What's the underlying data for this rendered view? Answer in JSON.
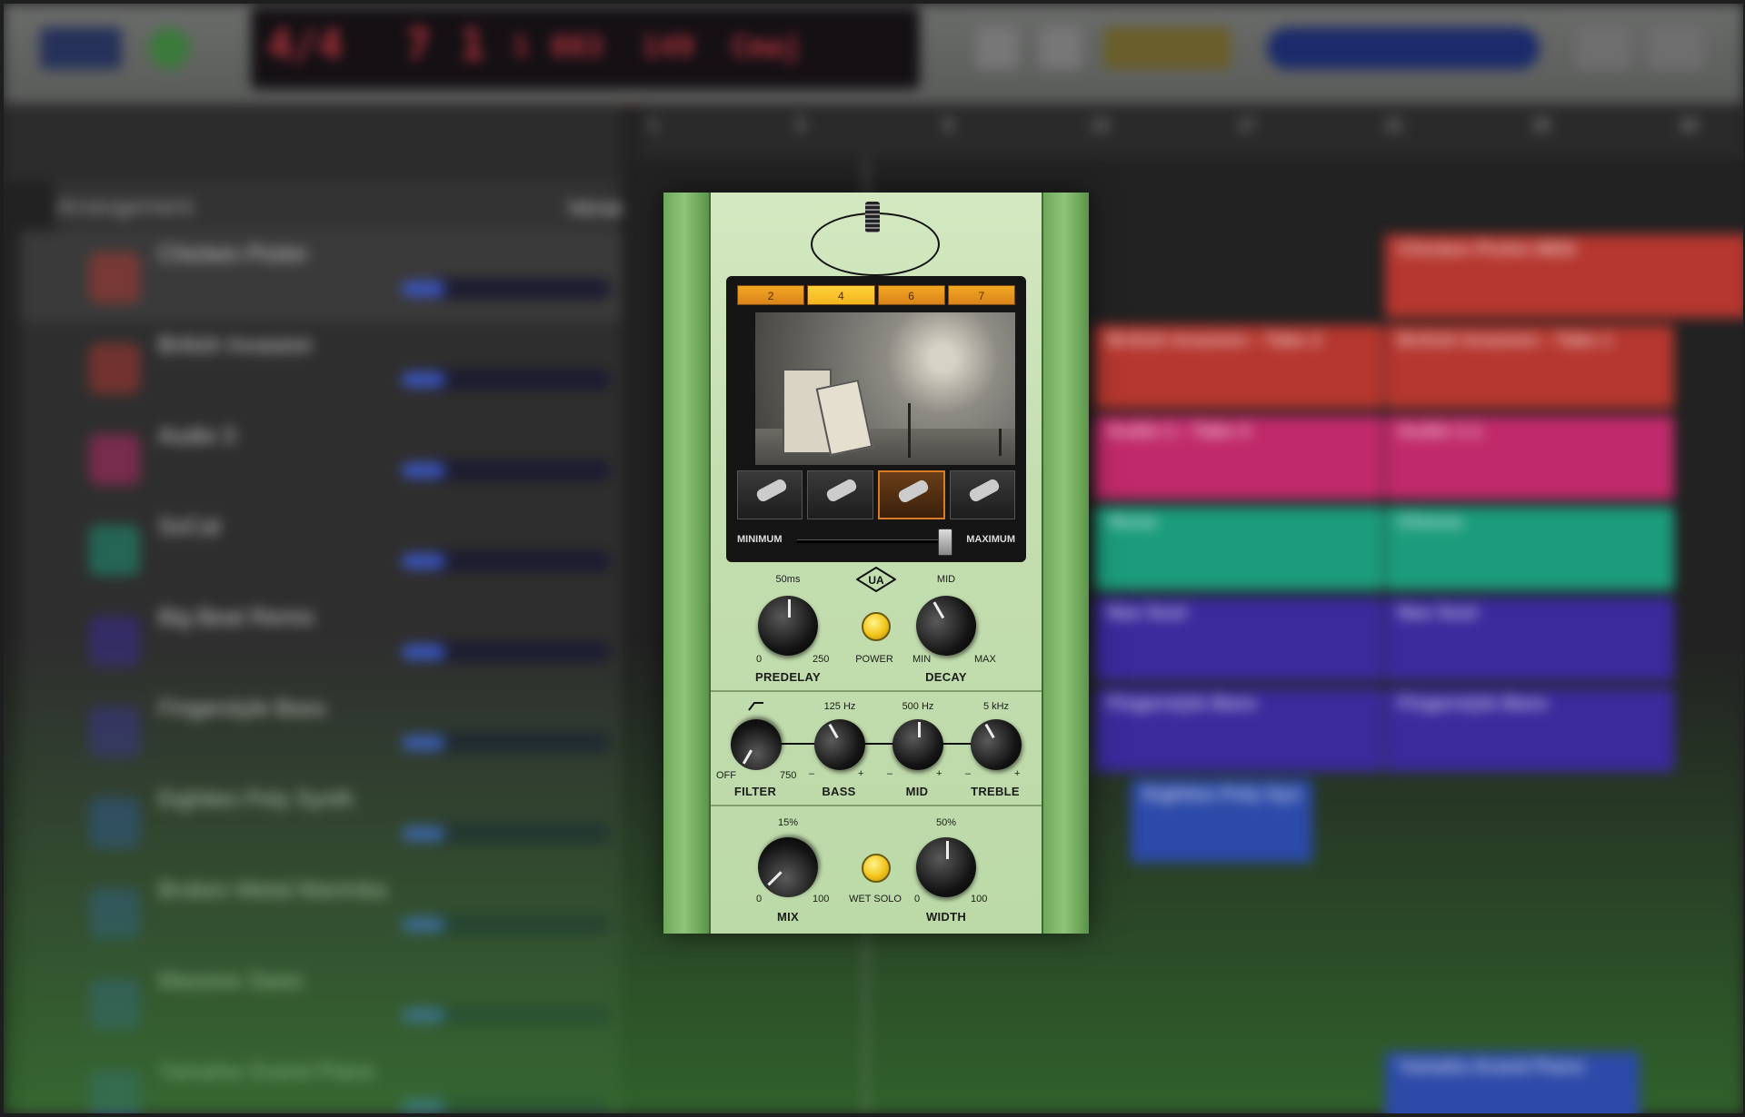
{
  "daw": {
    "lcd": {
      "bar": "7",
      "beat": "1",
      "division": "1",
      "tick": "003",
      "tempo": "149",
      "key": "Cmaj",
      "sig": "4/4"
    },
    "ruler_ticks": [
      "1",
      "5",
      "9",
      "13",
      "17",
      "21",
      "25",
      "29"
    ],
    "arrangement_label": "Arrangement",
    "sections": [
      "Verse",
      "Chorus"
    ],
    "tracks": [
      {
        "name": "Chicken Pickin",
        "color": "#b5372f"
      },
      {
        "name": "British Invasion",
        "color": "#b5372f"
      },
      {
        "name": "Audio 3",
        "color": "#c02a6a"
      },
      {
        "name": "SoCal",
        "color": "#1c9c7c"
      },
      {
        "name": "Big Beat Remix",
        "color": "#3a2a9c"
      },
      {
        "name": "Fingerstyle Bass",
        "color": "#3a2a9c"
      },
      {
        "name": "Eighties Poly Synth",
        "color": "#2c4aa8"
      },
      {
        "name": "Broken Metal Marimba",
        "color": "#2c4aa8"
      },
      {
        "name": "Massive Saws",
        "color": "#2c4aa8"
      },
      {
        "name": "Yamaha Grand Piano",
        "color": "#2c4aa8"
      }
    ],
    "regions": [
      {
        "track": 0,
        "label": "Chicken Pickin MIDI"
      },
      {
        "track": 1,
        "label": "British Invasion - Take 2"
      },
      {
        "track": 1,
        "label": "British Invasion - Take 1"
      },
      {
        "track": 2,
        "label": "Audio 1 - Take 4"
      },
      {
        "track": 2,
        "label": "Audio 1.1"
      },
      {
        "track": 3,
        "label": "Verse"
      },
      {
        "track": 3,
        "label": "Chorus"
      },
      {
        "track": 4,
        "label": "Nas Soul"
      },
      {
        "track": 4,
        "label": "Nas Soul"
      },
      {
        "track": 5,
        "label": "Fingerstyle Bass"
      },
      {
        "track": 5,
        "label": "Fingerstyle Bass"
      },
      {
        "track": 6,
        "label": "Eighties Poly Syn"
      },
      {
        "track": 9,
        "label": "Yamaha Grand Piano"
      }
    ]
  },
  "plugin": {
    "room_tabs": [
      "2",
      "4",
      "6",
      "7"
    ],
    "selected_tab": 1,
    "mics": [
      "ribbon-mic-icon",
      "tube-condenser-mic-icon",
      "small-condenser-mic-icon",
      "dynamic-mic-icon"
    ],
    "selected_mic": 2,
    "distance": {
      "min_label": "MINIMUM",
      "max_label": "MAXIMUM",
      "value": 0.95
    },
    "predelay": {
      "label": "PREDELAY",
      "value": "50ms",
      "min": "0",
      "max": "250"
    },
    "power": {
      "label": "POWER"
    },
    "decay": {
      "label": "DECAY",
      "value": "MID",
      "min": "MIN",
      "max": "MAX"
    },
    "filter": {
      "label": "FILTER",
      "min": "OFF",
      "max": "750"
    },
    "bass": {
      "label": "BASS",
      "value": "125 Hz",
      "minus": "–",
      "plus": "+"
    },
    "mid": {
      "label": "MID",
      "value": "500 Hz",
      "minus": "–",
      "plus": "+"
    },
    "treble": {
      "label": "TREBLE",
      "value": "5 kHz",
      "minus": "–",
      "plus": "+"
    },
    "mix": {
      "label": "MIX",
      "value": "15%",
      "min": "0",
      "max": "100"
    },
    "wet_solo": {
      "label": "WET SOLO"
    },
    "width": {
      "label": "WIDTH",
      "value": "50%",
      "min": "0",
      "max": "100"
    }
  },
  "colors": {
    "accent": "#f3b51d",
    "faceplate": "#c4deb0",
    "rails": "#6ea85a"
  }
}
